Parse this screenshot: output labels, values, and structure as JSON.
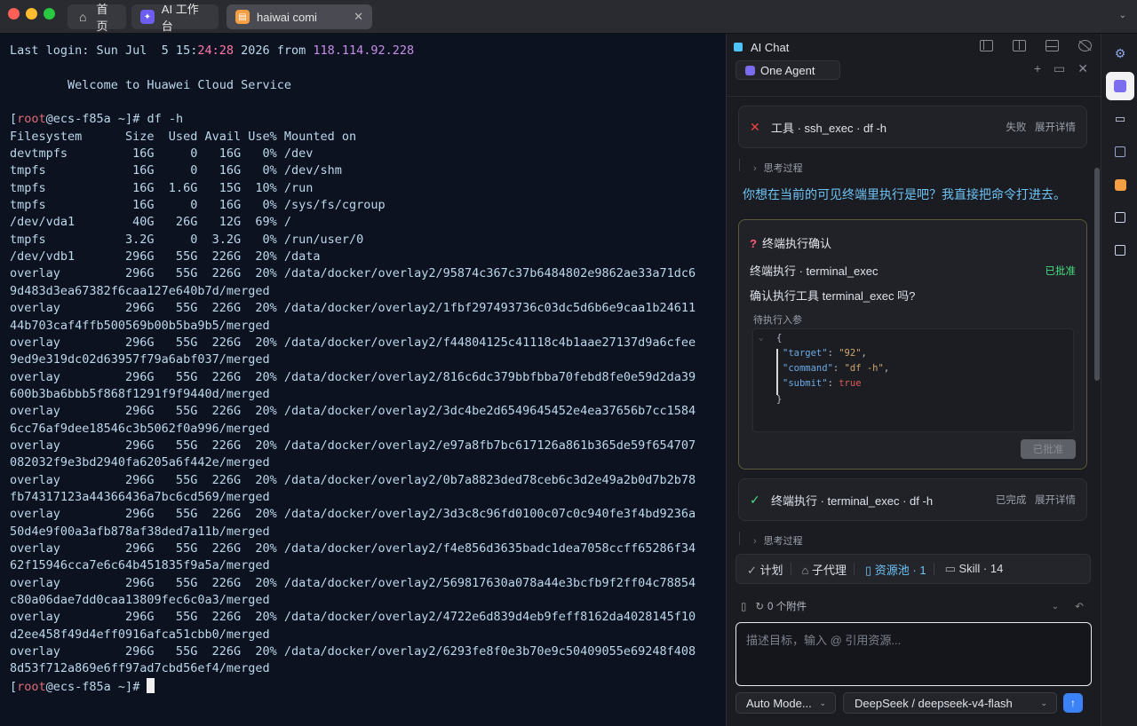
{
  "tabs": [
    {
      "label": "首页",
      "icon": "home-icon"
    },
    {
      "label": "AI 工作台",
      "icon": "ai-workspace-icon"
    },
    {
      "label": "haiwai comi",
      "icon": "terminal-app-icon"
    }
  ],
  "terminal": {
    "last_login_prefix": "Last login: Sun Jul  5 15:",
    "last_login_time_hi": "24:28",
    "last_login_mid": " 2026 from ",
    "last_login_ip": "118.114.92.228",
    "welcome": "        Welcome to Huawei Cloud Service",
    "prompt_open": "[",
    "prompt_user": "root",
    "prompt_rest": "@ecs-f85a ~]# ",
    "command": "df -h",
    "lines": [
      "Filesystem      Size  Used Avail Use% Mounted on",
      "devtmpfs         16G     0   16G   0% /dev",
      "tmpfs            16G     0   16G   0% /dev/shm",
      "tmpfs            16G  1.6G   15G  10% /run",
      "tmpfs            16G     0   16G   0% /sys/fs/cgroup",
      "/dev/vda1        40G   26G   12G  69% /",
      "tmpfs           3.2G     0  3.2G   0% /run/user/0",
      "/dev/vdb1       296G   55G  226G  20% /data",
      "overlay         296G   55G  226G  20% /data/docker/overlay2/95874c367c37b6484802e9862ae33a71dc6",
      "9d483d3ea67382f6caa127e640b7d/merged",
      "overlay         296G   55G  226G  20% /data/docker/overlay2/1fbf297493736c03dc5d6b6e9caa1b24611",
      "44b703caf4ffb500569b00b5ba9b5/merged",
      "overlay         296G   55G  226G  20% /data/docker/overlay2/f44804125c41118c4b1aae27137d9a6cfee",
      "9ed9e319dc02d63957f79a6abf037/merged",
      "overlay         296G   55G  226G  20% /data/docker/overlay2/816c6dc379bbfbba70febd8fe0e59d2da39",
      "600b3ba6bbb5f868f1291f9f9440d/merged",
      "overlay         296G   55G  226G  20% /data/docker/overlay2/3dc4be2d6549645452e4ea37656b7cc1584",
      "6cc76af9dee18546c3b5062f0a996/merged",
      "overlay         296G   55G  226G  20% /data/docker/overlay2/e97a8fb7bc617126a861b365de59f654707",
      "082032f9e3bd2940fa6205a6f442e/merged",
      "overlay         296G   55G  226G  20% /data/docker/overlay2/0b7a8823ded78ceb6c3d2e49a2b0d7b2b78",
      "fb74317123a44366436a7bc6cd569/merged",
      "overlay         296G   55G  226G  20% /data/docker/overlay2/3d3c8c96fd0100c07c0c940fe3f4bd9236a",
      "50d4e9f00a3afb878af38ded7a11b/merged",
      "overlay         296G   55G  226G  20% /data/docker/overlay2/f4e856d3635badc1dea7058ccff65286f34",
      "62f15946cca7e6c64b451835f9a5a/merged",
      "overlay         296G   55G  226G  20% /data/docker/overlay2/569817630a078a44e3bcfb9f2ff04c78854",
      "c80a06dae7dd0caa13809fec6c0a3/merged",
      "overlay         296G   55G  226G  20% /data/docker/overlay2/4722e6d839d4eb9feff8162da4028145f10",
      "d2ee458f49d4eff0916afca51cbb0/merged",
      "overlay         296G   55G  226G  20% /data/docker/overlay2/6293fe8f0e3b70e9c50409055e69248f408",
      "8d53f712a869e6ff97ad7cbd56ef4/merged"
    ]
  },
  "chat": {
    "title": "AI Chat",
    "agent_tab": "One Agent",
    "tool_failed": {
      "label": "工具 · ssh_exec · df -h",
      "status": "失败",
      "expand": "展开详情"
    },
    "think_label": "思考过程",
    "assistant_msg": "你想在当前的可见终端里执行是吧？我直接把命令打进去。",
    "confirm": {
      "title": "终端执行确认",
      "tool": "终端执行 · terminal_exec",
      "state": "已批准",
      "question": "确认执行工具 terminal_exec 吗?",
      "params_label": "待执行入参",
      "code_open": "{",
      "code_close": "}",
      "key_target": "\"target\"",
      "val_target": "\"92\"",
      "key_command": "\"command\"",
      "val_command": "\"df -h\"",
      "key_submit": "\"submit\"",
      "val_submit": "true",
      "button": "已批准"
    },
    "tool_done": {
      "label": "终端执行 · terminal_exec · df -h",
      "status": "已完成",
      "expand": "展开详情"
    },
    "bottom_tabs": [
      "计划",
      "子代理",
      "资源池 · 1",
      "Skill · 14"
    ],
    "attachments": "0 个附件",
    "input_placeholder": "描述目标，输入 @ 引用资源...",
    "mode": "Auto Mode...",
    "model": "DeepSeek / deepseek-v4-flash"
  }
}
